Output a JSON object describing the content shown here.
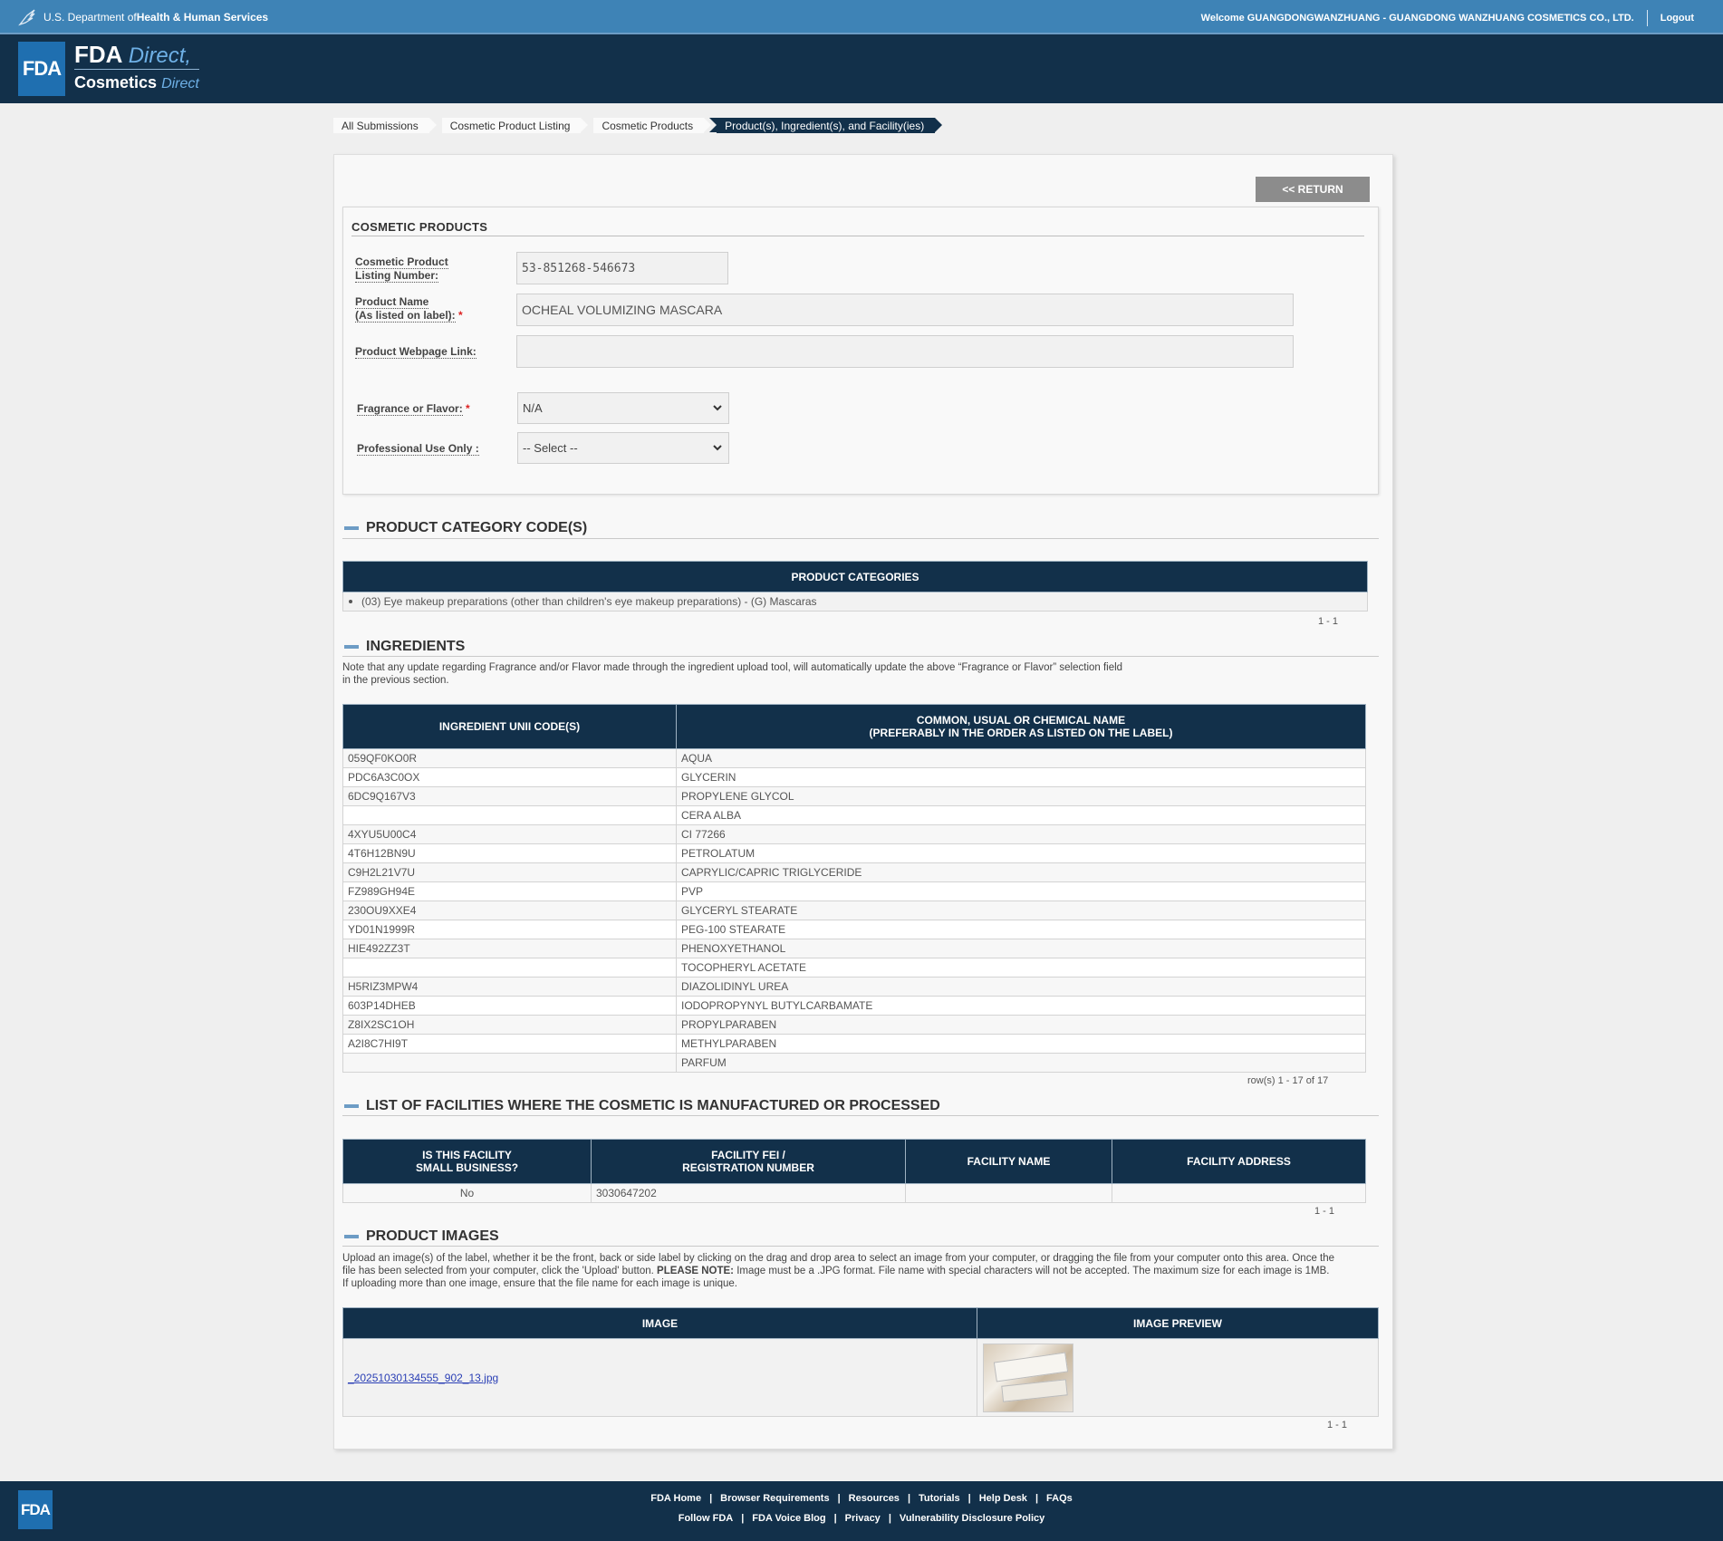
{
  "hhs": {
    "dept_prefix": "U.S. Department of ",
    "dept_name": "Health & Human Services",
    "welcome": "Welcome GUANGDONGWANZHUANG - GUANGDONG WANZHUANG COSMETICS CO., LTD.",
    "logout": "Logout"
  },
  "brand": {
    "logo": "FDA",
    "line1_bold": "FDA",
    "line1_italic": "Direct,",
    "line2_bold": "Cosmetics",
    "line2_italic": "Direct"
  },
  "breadcrumb": [
    "All Submissions",
    "Cosmetic Product Listing",
    "Cosmetic Products",
    "Product(s), Ingredient(s), and Facility(ies)"
  ],
  "return_button": "<< RETURN",
  "form": {
    "title": "COSMETIC PRODUCTS",
    "listing_label_1": "Cosmetic Product",
    "listing_label_2": "Listing Number:",
    "listing_value": "53-851268-546673",
    "product_name_label_1": "Product Name",
    "product_name_label_2": "(As listed on label):",
    "product_name_value": "OCHEAL VOLUMIZING MASCARA",
    "webpage_label": "Product Webpage Link:",
    "webpage_value": "",
    "fragrance_label": "Fragrance or Flavor:",
    "fragrance_value": "N/A",
    "professional_label": "Professional Use Only :",
    "professional_value": "-- Select --",
    "required_mark": "*"
  },
  "categories": {
    "heading": "PRODUCT CATEGORY CODE(S)",
    "column": "PRODUCT CATEGORIES",
    "rows": [
      "(03) Eye makeup preparations (other than children's eye makeup preparations) - (G) Mascaras"
    ],
    "pager": "1 - 1"
  },
  "ingredients": {
    "heading": "INGREDIENTS",
    "note_1": "Note that any update regarding Fragrance and/or Flavor made through the ingredient upload tool, will automatically update the above “Fragrance or Flavor” selection field",
    "note_2": "in the previous section.",
    "col1": "INGREDIENT UNII CODE(S)",
    "col2_line1": "COMMON, USUAL OR CHEMICAL NAME",
    "col2_line2": "(PREFERABLY IN THE ORDER AS LISTED ON THE LABEL)",
    "rows": [
      {
        "code": "059QF0KO0R",
        "name": "AQUA"
      },
      {
        "code": "PDC6A3C0OX",
        "name": "GLYCERIN"
      },
      {
        "code": "6DC9Q167V3",
        "name": "PROPYLENE GLYCOL"
      },
      {
        "code": "",
        "name": "CERA ALBA"
      },
      {
        "code": "4XYU5U00C4",
        "name": "CI 77266"
      },
      {
        "code": "4T6H12BN9U",
        "name": "PETROLATUM"
      },
      {
        "code": "C9H2L21V7U",
        "name": "CAPRYLIC/CAPRIC TRIGLYCERIDE"
      },
      {
        "code": "FZ989GH94E",
        "name": "PVP"
      },
      {
        "code": "230OU9XXE4",
        "name": "GLYCERYL STEARATE"
      },
      {
        "code": "YD01N1999R",
        "name": "PEG-100 STEARATE"
      },
      {
        "code": "HIE492ZZ3T",
        "name": "PHENOXYETHANOL"
      },
      {
        "code": "",
        "name": "TOCOPHERYL ACETATE"
      },
      {
        "code": "H5RIZ3MPW4",
        "name": "DIAZOLIDINYL UREA"
      },
      {
        "code": "603P14DHEB",
        "name": "IODOPROPYNYL BUTYLCARBAMATE"
      },
      {
        "code": "Z8IX2SC1OH",
        "name": "PROPYLPARABEN"
      },
      {
        "code": "A2I8C7HI9T",
        "name": "METHYLPARABEN"
      },
      {
        "code": "",
        "name": "PARFUM"
      }
    ],
    "pager": "row(s) 1 - 17 of 17"
  },
  "facilities": {
    "heading": "LIST OF FACILITIES WHERE THE COSMETIC IS MANUFACTURED OR PROCESSED",
    "col1_line1": "IS THIS FACILITY",
    "col1_line2": "SMALL BUSINESS?",
    "col2_line1": "FACILITY FEI /",
    "col2_line2": "REGISTRATION NUMBER",
    "col3": "FACILITY NAME",
    "col4": "FACILITY ADDRESS",
    "rows": [
      {
        "small_business": "No",
        "fei": "3030647202",
        "name": "",
        "address": ""
      }
    ],
    "pager": "1 - 1"
  },
  "images": {
    "heading": "PRODUCT IMAGES",
    "note_1": "Upload an image(s) of the label, whether it be the front, back or side label by clicking on the drag and drop area to select an image from your computer, or dragging the file from your computer onto this area. Once the",
    "note_2a": "file has been selected from your computer, click the 'Upload' button. ",
    "note_2b": "PLEASE NOTE:",
    "note_2c": " Image must be a .JPG format. File name with special characters will not be accepted. The maximum size for each image is 1MB.",
    "note_3": "If uploading more than one image, ensure that the file name for each image is unique.",
    "col1": "IMAGE",
    "col2": "IMAGE PREVIEW",
    "rows": [
      {
        "file": "_20251030134555_902_13.jpg"
      }
    ],
    "pager": "1 - 1"
  },
  "footer": {
    "logo": "FDA",
    "links_row1": [
      "FDA Home",
      "Browser Requirements",
      "Resources",
      "Tutorials",
      "Help Desk",
      "FAQs"
    ],
    "links_row2": [
      "Follow FDA",
      "FDA Voice Blog",
      "Privacy",
      "Vulnerability Disclosure Policy"
    ],
    "separator": "|"
  },
  "colors": {
    "hhs_bar": "#3e83b6",
    "header_navy": "#12304a",
    "logo_blue": "#1f6fb0",
    "return_gray": "#8c8c8c",
    "required_red": "#dd2222",
    "link_blue": "#2a3fb5"
  }
}
